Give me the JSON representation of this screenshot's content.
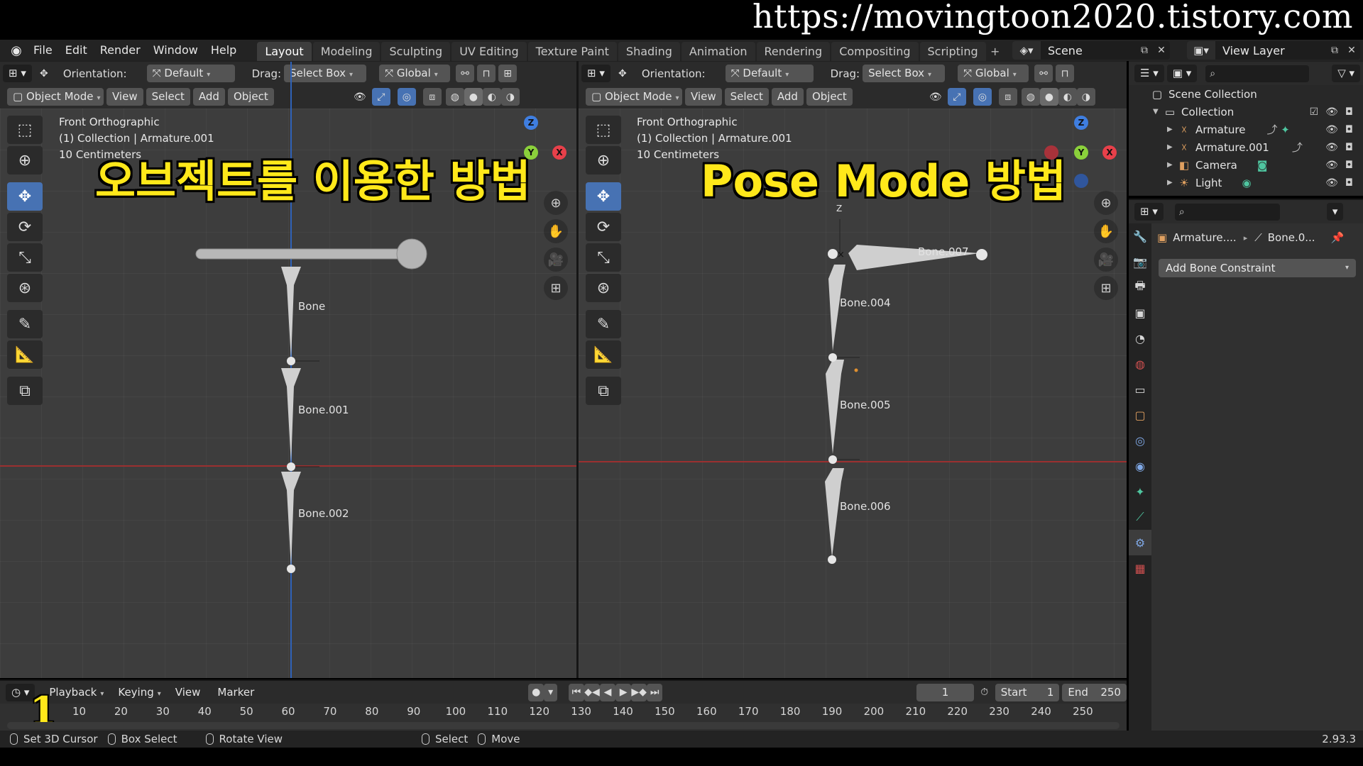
{
  "watermark": "https://movingtoon2020.tistory.com",
  "menu": [
    "File",
    "Edit",
    "Render",
    "Window",
    "Help"
  ],
  "workspaces": [
    "Layout",
    "Modeling",
    "Sculpting",
    "UV Editing",
    "Texture Paint",
    "Shading",
    "Animation",
    "Rendering",
    "Compositing",
    "Scripting"
  ],
  "active_workspace": "Layout",
  "scene": "Scene",
  "view_layer": "View Layer",
  "viewport_header": {
    "orientation_label": "Orientation:",
    "orientation_value": "Default",
    "drag_label": "Drag:",
    "drag_value": "Select Box",
    "transform_value": "Global",
    "mode": "Object Mode",
    "view": "View",
    "select": "Select",
    "add": "Add",
    "object": "Object"
  },
  "left_viewport": {
    "info": [
      "Front Orthographic",
      "(1) Collection | Armature.001",
      "10 Centimeters"
    ],
    "caption": "오브젝트를 이용한 방법",
    "bones": [
      "Bone",
      "Bone.001",
      "Bone.002"
    ],
    "axes": {
      "x": "X",
      "y": "Y",
      "z": "Z"
    }
  },
  "right_viewport": {
    "info": [
      "Front Orthographic",
      "(1) Collection | Armature.001",
      "10 Centimeters"
    ],
    "caption": "Pose Mode 방법",
    "bones": [
      "Bone.007",
      "Bone.004",
      "Bone.005",
      "Bone.006"
    ],
    "axes": {
      "x": "X",
      "y": "Y",
      "z": "Z"
    },
    "axis_letter_z": "Z"
  },
  "outliner": {
    "root": "Scene Collection",
    "collection": "Collection",
    "items": [
      "Armature",
      "Armature.001",
      "Camera",
      "Light"
    ]
  },
  "properties": {
    "crumb_object": "Armature....",
    "crumb_bone": "Bone.0...",
    "add_constraint": "Add Bone Constraint"
  },
  "timeline": {
    "playback": "Playback",
    "keying": "Keying",
    "view": "View",
    "marker": "Marker",
    "current_frame": "1",
    "start_label": "Start",
    "start": "1",
    "end_label": "End",
    "end": "250",
    "ticks": [
      "10",
      "20",
      "30",
      "40",
      "50",
      "60",
      "70",
      "80",
      "90",
      "100",
      "110",
      "120",
      "130",
      "140",
      "150",
      "160",
      "170",
      "180",
      "190",
      "200",
      "210",
      "220",
      "230",
      "240",
      "250"
    ],
    "frame_overlay": "1"
  },
  "status": {
    "set_cursor": "Set 3D Cursor",
    "box_select": "Box Select",
    "rotate_view": "Rotate View",
    "select": "Select",
    "move": "Move",
    "version": "2.93.3"
  },
  "colors": {
    "accent": "#4772b3",
    "caption": "#ffe81a",
    "x_axis": "#e8404a",
    "y_axis": "#8bd13b",
    "z_axis": "#3f7ee0"
  }
}
